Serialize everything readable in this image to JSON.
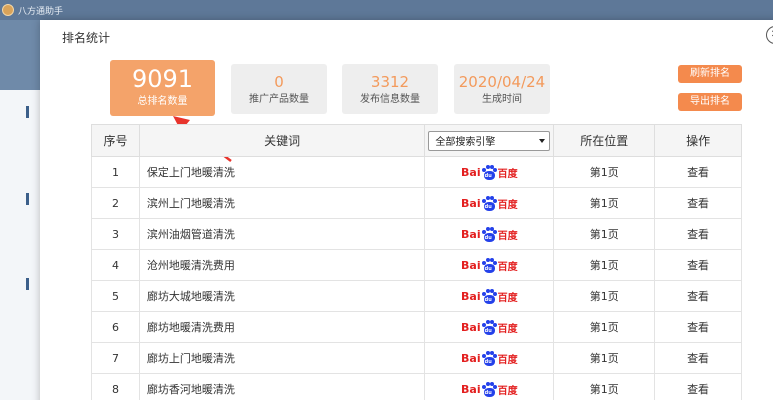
{
  "app": {
    "title": "八方通助手"
  },
  "modal": {
    "title": "排名统计",
    "close_symbol": "✕"
  },
  "stats": [
    {
      "value": "9091",
      "label": "总排名数量"
    },
    {
      "value": "0",
      "label": "推广产品数量"
    },
    {
      "value": "3312",
      "label": "发布信息数量"
    },
    {
      "value": "2020/04/24",
      "label": "生成时间"
    }
  ],
  "buttons": {
    "refresh": "刷新排名",
    "export": "导出排名"
  },
  "table": {
    "headers": {
      "index": "序号",
      "keyword": "关键词",
      "engine_select": "全部搜索引擎",
      "position": "所在位置",
      "action": "操作"
    },
    "engine_logo": {
      "part1": "Bai",
      "paw_text": "du",
      "part2": "百度"
    },
    "rows": [
      {
        "index": "1",
        "keyword": "保定上门地暖清洗",
        "position": "第1页",
        "action": "查看"
      },
      {
        "index": "2",
        "keyword": "滨州上门地暖清洗",
        "position": "第1页",
        "action": "查看"
      },
      {
        "index": "3",
        "keyword": "滨州油烟管道清洗",
        "position": "第1页",
        "action": "查看"
      },
      {
        "index": "4",
        "keyword": "沧州地暖清洗费用",
        "position": "第1页",
        "action": "查看"
      },
      {
        "index": "5",
        "keyword": "廊坊大城地暖清洗",
        "position": "第1页",
        "action": "查看"
      },
      {
        "index": "6",
        "keyword": "廊坊地暖清洗费用",
        "position": "第1页",
        "action": "查看"
      },
      {
        "index": "7",
        "keyword": "廊坊上门地暖清洗",
        "position": "第1页",
        "action": "查看"
      },
      {
        "index": "8",
        "keyword": "廊坊香河地暖清洗",
        "position": "第1页",
        "action": "查看"
      }
    ]
  },
  "colors": {
    "accent": "#f4a36a",
    "button": "#f48a4d",
    "arrow": "#e8342c",
    "baidu_red": "#e31f1f",
    "baidu_blue": "#2441ea"
  }
}
